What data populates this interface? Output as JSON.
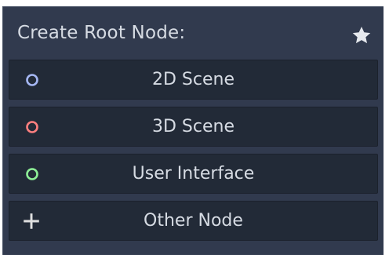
{
  "dock": {
    "title": "Create Root Node:",
    "favorite_icon": "star-icon"
  },
  "buttons": [
    {
      "label": "2D Scene",
      "icon": "node2d-circle-icon",
      "icon_color": "#a5b7f3"
    },
    {
      "label": "3D Scene",
      "icon": "spatial-circle-icon",
      "icon_color": "#fc7f7f"
    },
    {
      "label": "User Interface",
      "icon": "control-circle-icon",
      "icon_color": "#8eef97"
    },
    {
      "label": "Other Node",
      "icon": "plus-icon",
      "icon_color": "#e0e0e0"
    }
  ],
  "colors": {
    "panel_bg": "#313a4e",
    "button_bg": "#222a37",
    "text": "#d6dbe3"
  }
}
